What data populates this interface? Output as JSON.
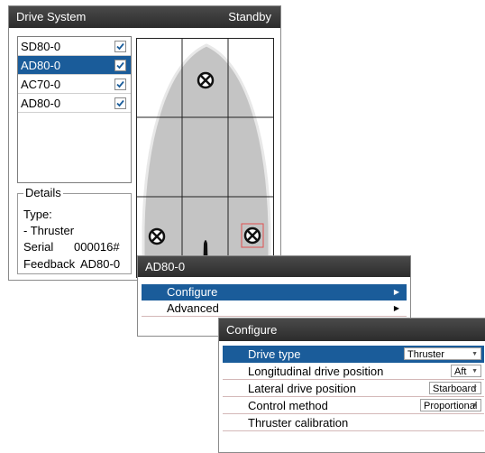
{
  "main_window": {
    "title": "Drive System",
    "status": "Standby"
  },
  "devices": [
    {
      "name": "SD80-0",
      "checked": true,
      "selected": false
    },
    {
      "name": "AD80-0",
      "checked": true,
      "selected": true
    },
    {
      "name": "AC70-0",
      "checked": true,
      "selected": false
    },
    {
      "name": "AD80-0",
      "checked": true,
      "selected": false
    }
  ],
  "details": {
    "legend": "Details",
    "type_label": "Type:",
    "type_value": "- Thruster",
    "serial_label": "Serial",
    "serial_value": "000016#",
    "feedback_label": "Feedback",
    "feedback_value": "AD80-0"
  },
  "device_menu": {
    "title": "AD80-0",
    "items": [
      {
        "label": "Configure",
        "selected": true
      },
      {
        "label": "Advanced",
        "selected": false
      }
    ]
  },
  "configure_dialog": {
    "title": "Configure",
    "rows": [
      {
        "label": "Drive type",
        "value": "Thruster",
        "selected": true
      },
      {
        "label": "Longitudinal drive position",
        "value": "Aft",
        "selected": false
      },
      {
        "label": "Lateral drive position",
        "value": "Starboard",
        "selected": false
      },
      {
        "label": "Control method",
        "value": "Proportional",
        "selected": false
      },
      {
        "label": "Thruster calibration",
        "value": "",
        "selected": false
      }
    ]
  },
  "colors": {
    "selection": "#1a5c9a",
    "titlebar": "#333333",
    "hull": "#c4c4c4",
    "highlight_box": "#e05050"
  }
}
